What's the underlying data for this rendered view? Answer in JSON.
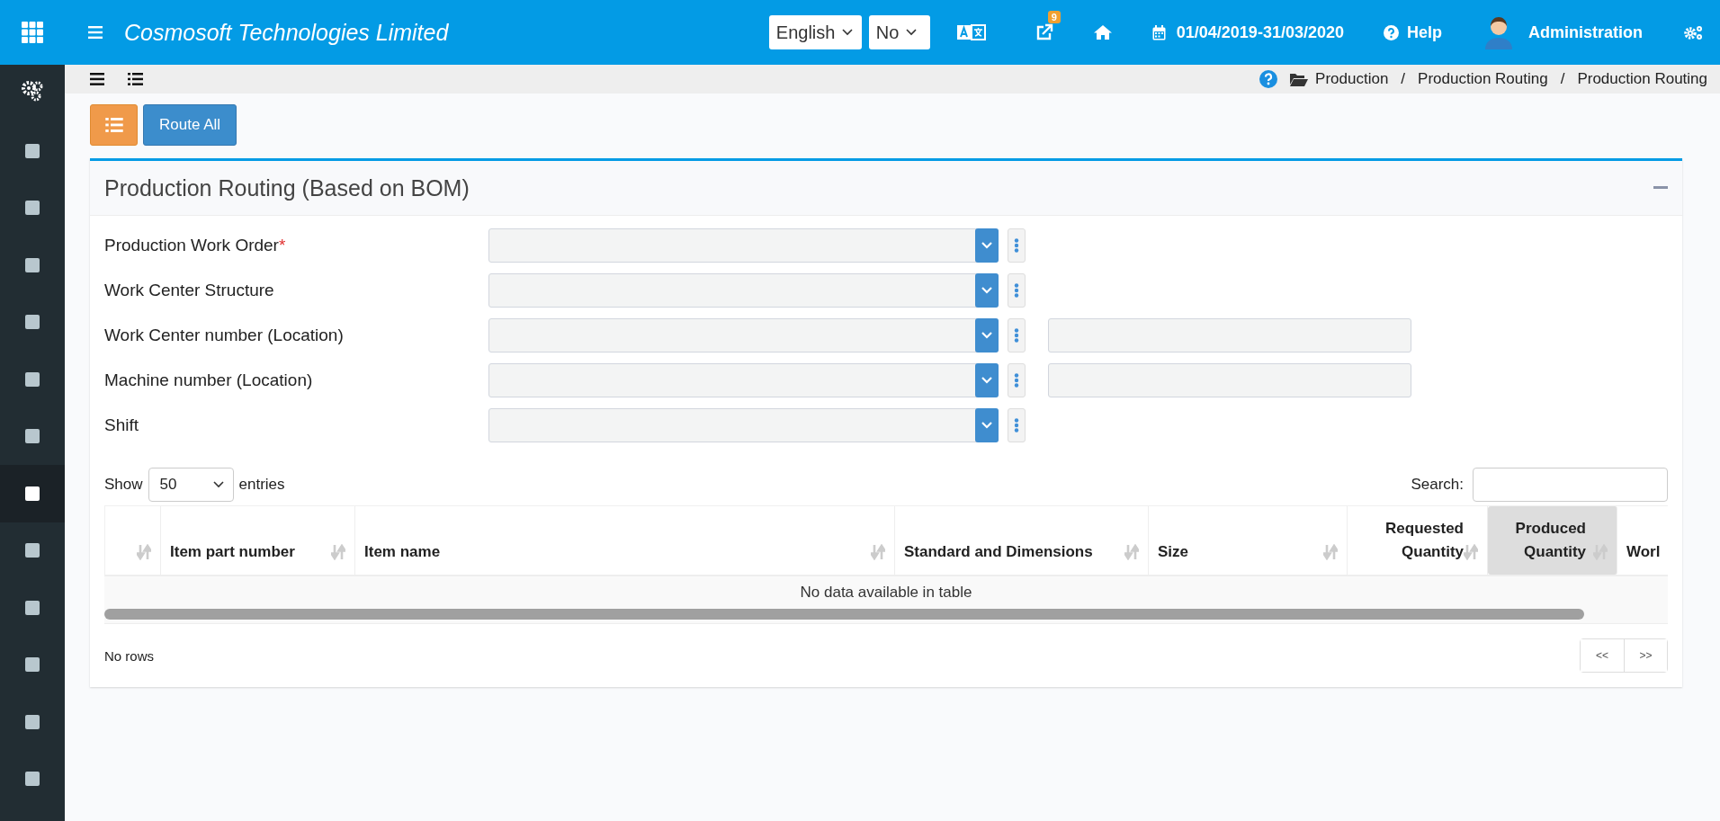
{
  "topbar": {
    "title": "Cosmosoft Technologies Limited",
    "language": "English",
    "option": "No",
    "notification_badge": "9",
    "period": "01/04/2019-31/03/2020",
    "help": "Help",
    "user": "Administration"
  },
  "sidebar": {
    "items": [
      {
        "kind": "gears",
        "selected": false
      },
      {
        "kind": "square",
        "selected": false
      },
      {
        "kind": "square",
        "selected": false
      },
      {
        "kind": "square",
        "selected": false
      },
      {
        "kind": "square",
        "selected": false
      },
      {
        "kind": "square",
        "selected": false
      },
      {
        "kind": "square",
        "selected": false
      },
      {
        "kind": "square",
        "selected": true
      },
      {
        "kind": "square",
        "selected": false
      },
      {
        "kind": "square",
        "selected": false
      },
      {
        "kind": "square",
        "selected": false
      },
      {
        "kind": "square",
        "selected": false
      },
      {
        "kind": "square",
        "selected": false
      }
    ]
  },
  "breadcrumb": {
    "separator": "/",
    "items": [
      "Production",
      "Production Routing",
      "Production Routing"
    ]
  },
  "toolbar": {
    "route_button": "Route All"
  },
  "panel": {
    "title": "Production Routing (Based on BOM)",
    "fields": [
      {
        "label": "Production Work Order",
        "required_mark": "*",
        "extra_field": false
      },
      {
        "label": "Work Center Structure",
        "extra_field": false
      },
      {
        "label": "Work Center number (Location)",
        "extra_field": true
      },
      {
        "label": "Machine number (Location)",
        "extra_field": true
      },
      {
        "label": "Shift",
        "extra_field": false
      }
    ]
  },
  "table": {
    "show_label": "Show",
    "page_length": "50",
    "entries_label": "entries",
    "search_label": "Search:",
    "columns": [
      {
        "sortable": true,
        "selected": false
      },
      {
        "label": "Item part number",
        "sortable": true,
        "selected": false
      },
      {
        "label": "Item name",
        "sortable": true,
        "selected": false
      },
      {
        "label": "Standard and Dimensions",
        "sortable": true,
        "selected": false
      },
      {
        "label": "Size",
        "sortable": true,
        "selected": false
      },
      {
        "label": "Requested Quantity",
        "sortable": true,
        "selected": false
      },
      {
        "label": "Produced Quantity",
        "sortable": true,
        "selected": true
      },
      {
        "label": "Worl",
        "sortable": false,
        "selected": false
      }
    ],
    "empty_message": "No data available in table",
    "info": "No rows",
    "pager": [
      "<<",
      ">>"
    ]
  }
}
